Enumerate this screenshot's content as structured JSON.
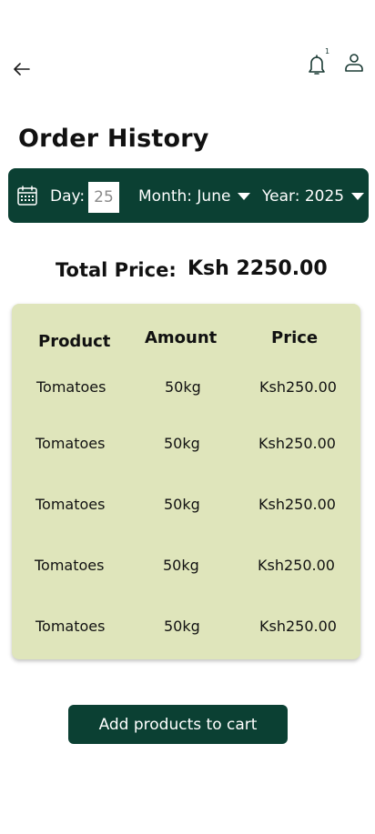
{
  "header": {
    "notification_count": "1"
  },
  "page": {
    "title": "Order History"
  },
  "filters": {
    "day_label": "Day:",
    "day_value": "25",
    "month_label": "Month: June",
    "year_label": "Year: 2025"
  },
  "total": {
    "label": "Total Price:",
    "value": "Ksh 2250.00"
  },
  "table": {
    "headers": [
      "Product",
      "Amount",
      "Price"
    ],
    "rows": [
      [
        "Tomatoes",
        "50kg",
        "Ksh250.00"
      ],
      [
        "Tomatoes",
        "50kg",
        "Ksh250.00"
      ],
      [
        "Tomatoes",
        "50kg",
        "Ksh250.00"
      ],
      [
        "Tomatoes",
        "50kg",
        "Ksh250.00"
      ],
      [
        "Tomatoes",
        "50kg",
        "Ksh250.00"
      ]
    ]
  },
  "actions": {
    "add_to_cart_label": "Add products to cart"
  },
  "colors": {
    "primary": "#0b4033",
    "card": "#dfe5bb"
  },
  "icons": [
    "back-arrow-icon",
    "bell-icon",
    "user-icon",
    "calendar-icon",
    "dropdown-triangle-icon"
  ]
}
